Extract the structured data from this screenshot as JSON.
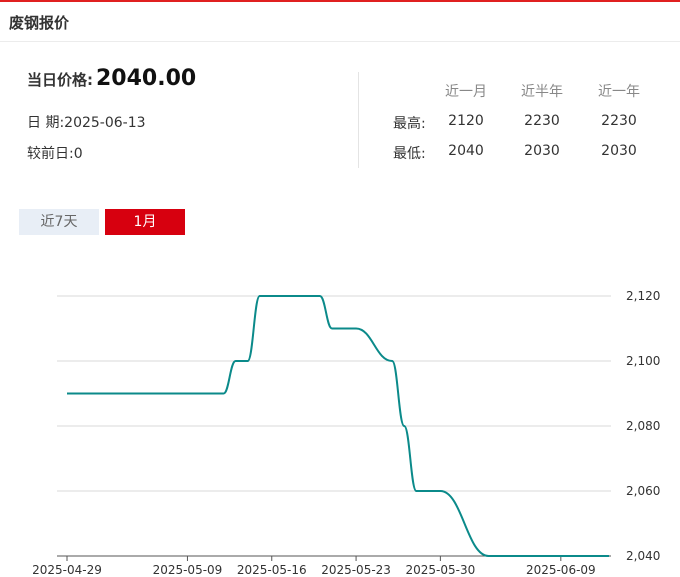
{
  "header": {
    "title": "废钢报价"
  },
  "price": {
    "label": "当日价格:",
    "value": "2040.00"
  },
  "date": {
    "label": "日 期:",
    "value": "2025-06-13"
  },
  "change": {
    "label": "较前日:",
    "value": "0"
  },
  "stats": {
    "columns": [
      "近一月",
      "近半年",
      "近一年"
    ],
    "high": {
      "label": "最高:",
      "values": [
        "2120",
        "2230",
        "2230"
      ]
    },
    "low": {
      "label": "最低:",
      "values": [
        "2040",
        "2030",
        "2030"
      ]
    }
  },
  "tabs": [
    {
      "label": "近7天",
      "active": false
    },
    {
      "label": "1月",
      "active": true
    }
  ],
  "colors": {
    "accent": "#d7000f",
    "line": "#0b8a8a",
    "grid": "#d9d9d9"
  },
  "chart_data": {
    "type": "line",
    "title": "",
    "xlabel": "",
    "ylabel": "",
    "ylim": [
      2040,
      2120
    ],
    "yticks": [
      2040,
      2060,
      2080,
      2100,
      2120
    ],
    "ytick_labels": [
      "2,040",
      "2,060",
      "2,080",
      "2,100",
      "2,120"
    ],
    "yaxis_position": "right",
    "grid": true,
    "xlim": [
      "2025-04-29",
      "2025-06-13"
    ],
    "xtick_labels": [
      "2025-04-29",
      "2025-05-09",
      "2025-05-16",
      "2025-05-23",
      "2025-05-30",
      "2025-06-09"
    ],
    "x": [
      "2025-04-29",
      "2025-05-09",
      "2025-05-12",
      "2025-05-13",
      "2025-05-14",
      "2025-05-15",
      "2025-05-16",
      "2025-05-19",
      "2025-05-20",
      "2025-05-21",
      "2025-05-22",
      "2025-05-23",
      "2025-05-26",
      "2025-05-27",
      "2025-05-28",
      "2025-05-29",
      "2025-05-30",
      "2025-06-03",
      "2025-06-04",
      "2025-06-05",
      "2025-06-06",
      "2025-06-09",
      "2025-06-10",
      "2025-06-11",
      "2025-06-12",
      "2025-06-13"
    ],
    "series": [
      {
        "values": [
          2090,
          2090,
          2090,
          2100,
          2100,
          2120,
          2120,
          2120,
          2120,
          2110,
          2110,
          2110,
          2100,
          2080,
          2060,
          2060,
          2060,
          2040,
          2040,
          2040,
          2040,
          2040,
          2040,
          2040,
          2040,
          2040
        ]
      }
    ]
  }
}
